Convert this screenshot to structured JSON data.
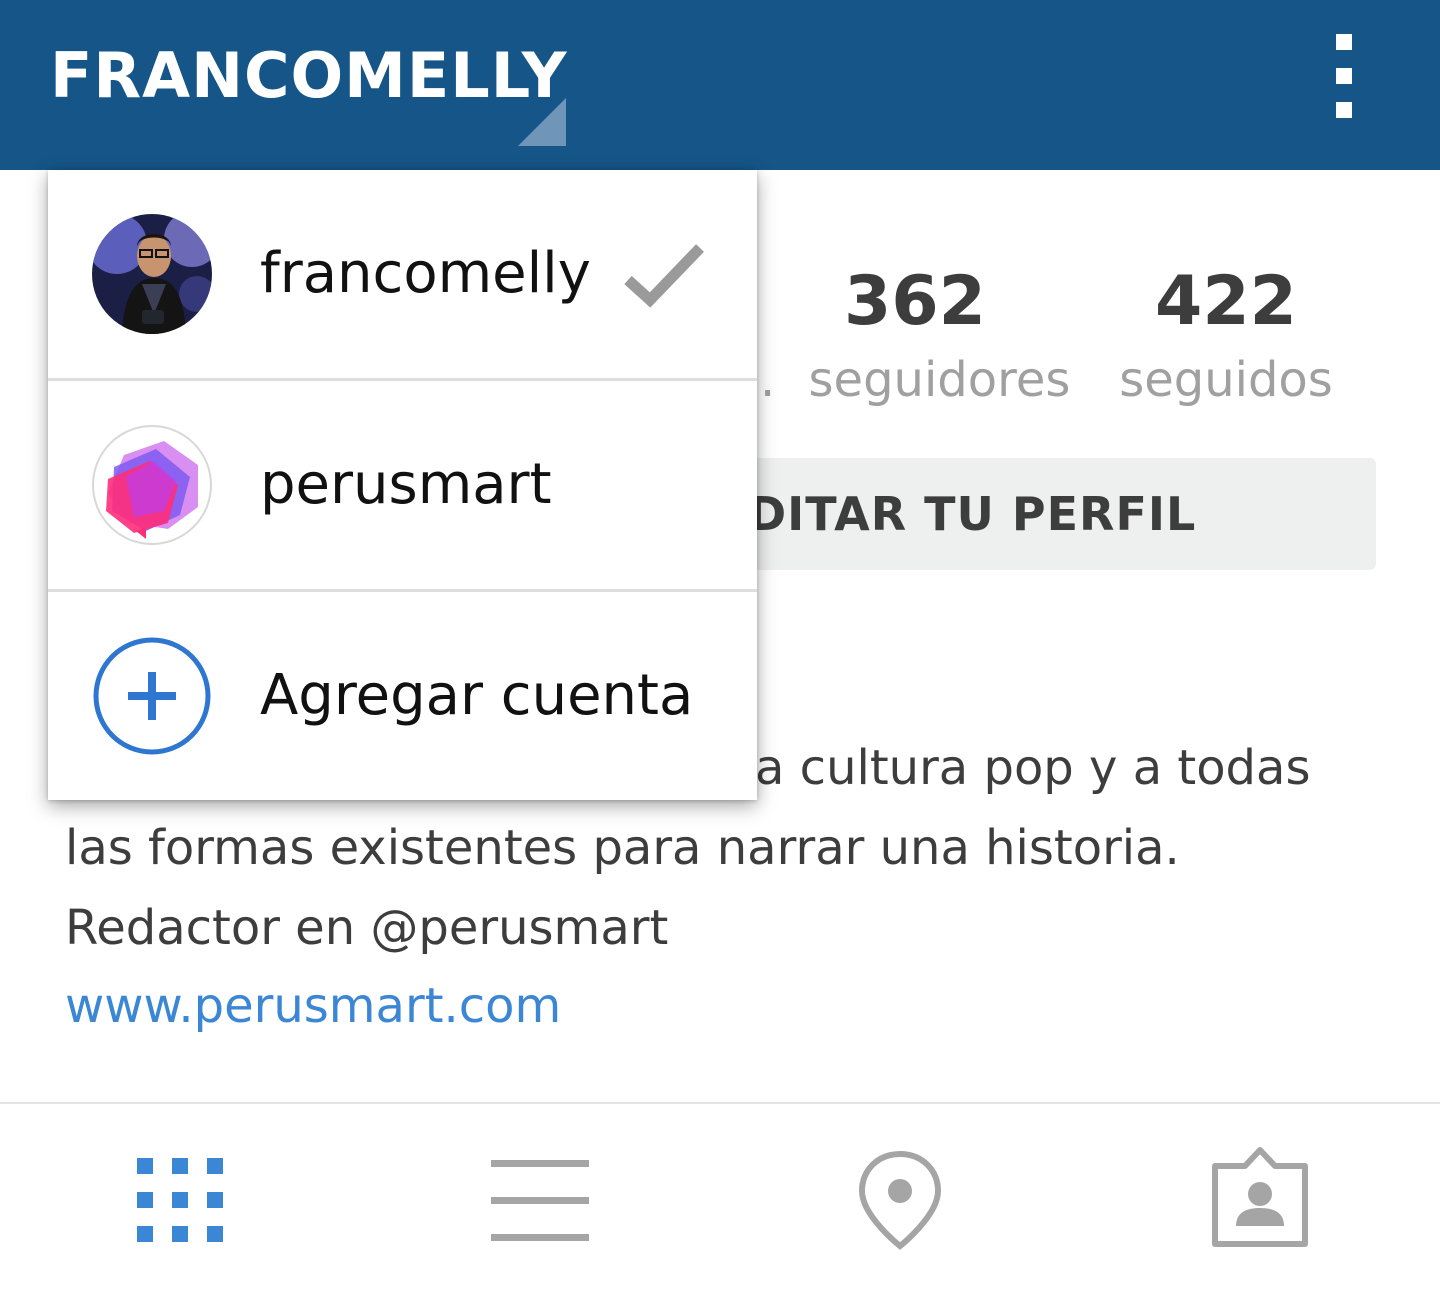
{
  "header": {
    "title": "FRANCOMELLY",
    "account_switch_icon": "triangle-corner-icon",
    "overflow_icon": "vertical-dots-icon",
    "bg_color": "#155587"
  },
  "stats": {
    "followers": {
      "value": "362",
      "label": "seguidores",
      "prefix_fragment": "."
    },
    "following": {
      "value": "422",
      "label": "seguidos"
    }
  },
  "edit_profile_button": {
    "label": "DITAR TU PERFIL"
  },
  "bio": {
    "line1_visible": "a cultura pop y a todas",
    "line2": "las formas existentes para narrar una historia.",
    "line3": "Redactor en @perusmart",
    "website": "www.perusmart.com"
  },
  "tabs": [
    {
      "name": "grid",
      "icon": "grid-icon",
      "active": true
    },
    {
      "name": "list",
      "icon": "list-icon",
      "active": false
    },
    {
      "name": "places",
      "icon": "map-pin-icon",
      "active": false
    },
    {
      "name": "tagged",
      "icon": "tagged-photos-icon",
      "active": false
    }
  ],
  "account_menu": {
    "items": [
      {
        "label": "francomelly",
        "selected": true,
        "avatar": "profile-photo"
      },
      {
        "label": "perusmart",
        "selected": false,
        "avatar": "perusmart-logo"
      },
      {
        "label": "Agregar cuenta",
        "selected": false,
        "avatar": "plus-circle-icon"
      }
    ]
  },
  "colors": {
    "accent_blue": "#3b87d6",
    "tab_inactive": "#a5a5a5",
    "check": "#9a9a9a"
  }
}
